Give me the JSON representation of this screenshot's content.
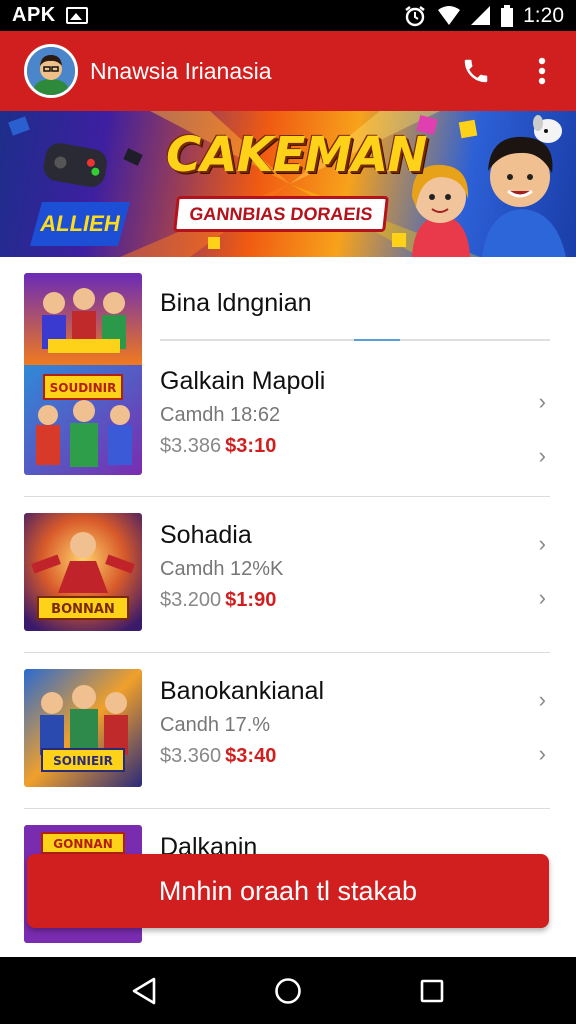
{
  "status_bar": {
    "left_label": "APK",
    "time": "1:20"
  },
  "app_bar": {
    "title": "Nnawsia Irianasia"
  },
  "banner": {
    "title": "CAKEMAN",
    "subtitle": "GANNBIAS DORAEIS",
    "badge": "ALLIEH"
  },
  "list": {
    "header": "Bina ldngnian",
    "items": [
      {
        "title": "Galkain Mapoli",
        "meta": "Camdh 18:62",
        "price_old": "$3.386",
        "price_new": "$3:10",
        "thumb_label": "SOUDINIR"
      },
      {
        "title": "Sohadia",
        "meta": "Camdh 12%K",
        "price_old": "$3.200",
        "price_new": "$1:90",
        "thumb_label": "BONNAN"
      },
      {
        "title": "Banokankianal",
        "meta": "Candh 17.%",
        "price_old": "$3.360",
        "price_new": "$3:40",
        "thumb_label": "SOINIEIR"
      },
      {
        "title": "Dalkanin",
        "thumb_label": "GONNAN"
      }
    ]
  },
  "cta": {
    "label": "Mnhin oraah tl stakab"
  },
  "icons": {
    "phone": "phone-icon",
    "more": "more-vert-icon",
    "back": "back-icon",
    "home": "home-icon",
    "recents": "recents-icon"
  },
  "colors": {
    "primary": "#d11f1f",
    "sale": "#d11f1f"
  }
}
